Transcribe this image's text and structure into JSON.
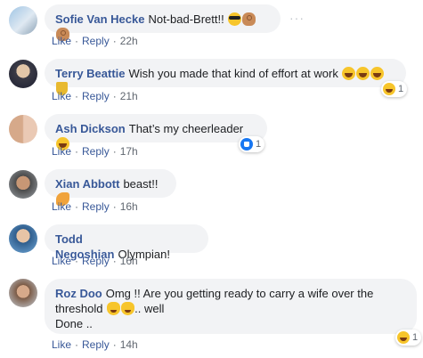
{
  "actions": {
    "like": "Like",
    "reply": "Reply",
    "separator": "·"
  },
  "comments": [
    {
      "author": "Sofie Van Hecke",
      "text": "Not-bad-Brett!!",
      "emojis": [
        "smiling-face-with-sunglasses",
        "ok-hand",
        "ok-hand"
      ],
      "time": "22h",
      "more": "···"
    },
    {
      "author": "Terry Beattie",
      "text": "Wish you made that kind of effort at work",
      "emojis": [
        "laughing-face",
        "laughing-face",
        "laughing-face",
        "trophy"
      ],
      "time": "21h",
      "reaction": {
        "icon": "haha-reaction",
        "count": "1"
      }
    },
    {
      "author": "Ash Dickson",
      "text": "That’s my cheerleader",
      "emojis": [
        "laughing-face"
      ],
      "time": "17h",
      "reaction": {
        "icon": "like-reaction",
        "count": "1"
      }
    },
    {
      "author": "Xian Abbott",
      "text": "beast!!",
      "emojis": [
        "flexed-biceps"
      ],
      "time": "16h"
    },
    {
      "author": "Todd Negoshian",
      "text": "Olympian!",
      "emojis": [],
      "time": "16h"
    },
    {
      "author": "Roz Doo",
      "text_line1": "Omg !! Are you getting ready to carry a wife over the",
      "text_line2_pre": "threshold",
      "text_line2_post": ".. well",
      "text_line3": "Done ..",
      "emojis": [
        "grinning-cat",
        "grinning-cat"
      ],
      "time": "14h",
      "reaction": {
        "icon": "haha-reaction",
        "count": "1"
      }
    }
  ]
}
